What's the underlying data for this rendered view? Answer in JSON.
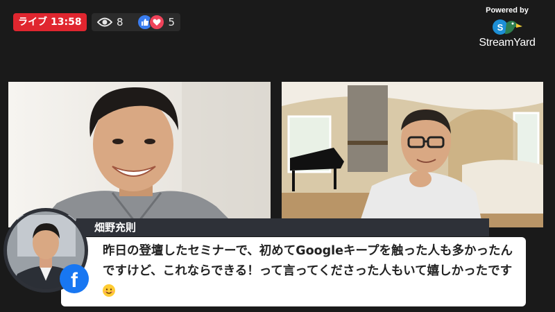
{
  "live": {
    "label": "ライブ",
    "time": "13:58"
  },
  "stats": {
    "views": "8",
    "reactions": "5"
  },
  "icons": [
    "eye-icon",
    "like-icon",
    "love-icon",
    "facebook-icon",
    "streamyard-logo-icon"
  ],
  "branding": {
    "powered_by": "Powered by",
    "brand": "StreamYard"
  },
  "comment": {
    "author": "畑野充則",
    "text": "昨日の登壇したセミナーで、初めてGoogleキープを触った人も多かったんですけど、これならできる！って言ってくださった人もいて嬉しかったです",
    "emoji": "smiling-face-icon"
  },
  "colors": {
    "live": "#e0262f",
    "facebook": "#1877f2",
    "name_bar": "#2e3138"
  }
}
